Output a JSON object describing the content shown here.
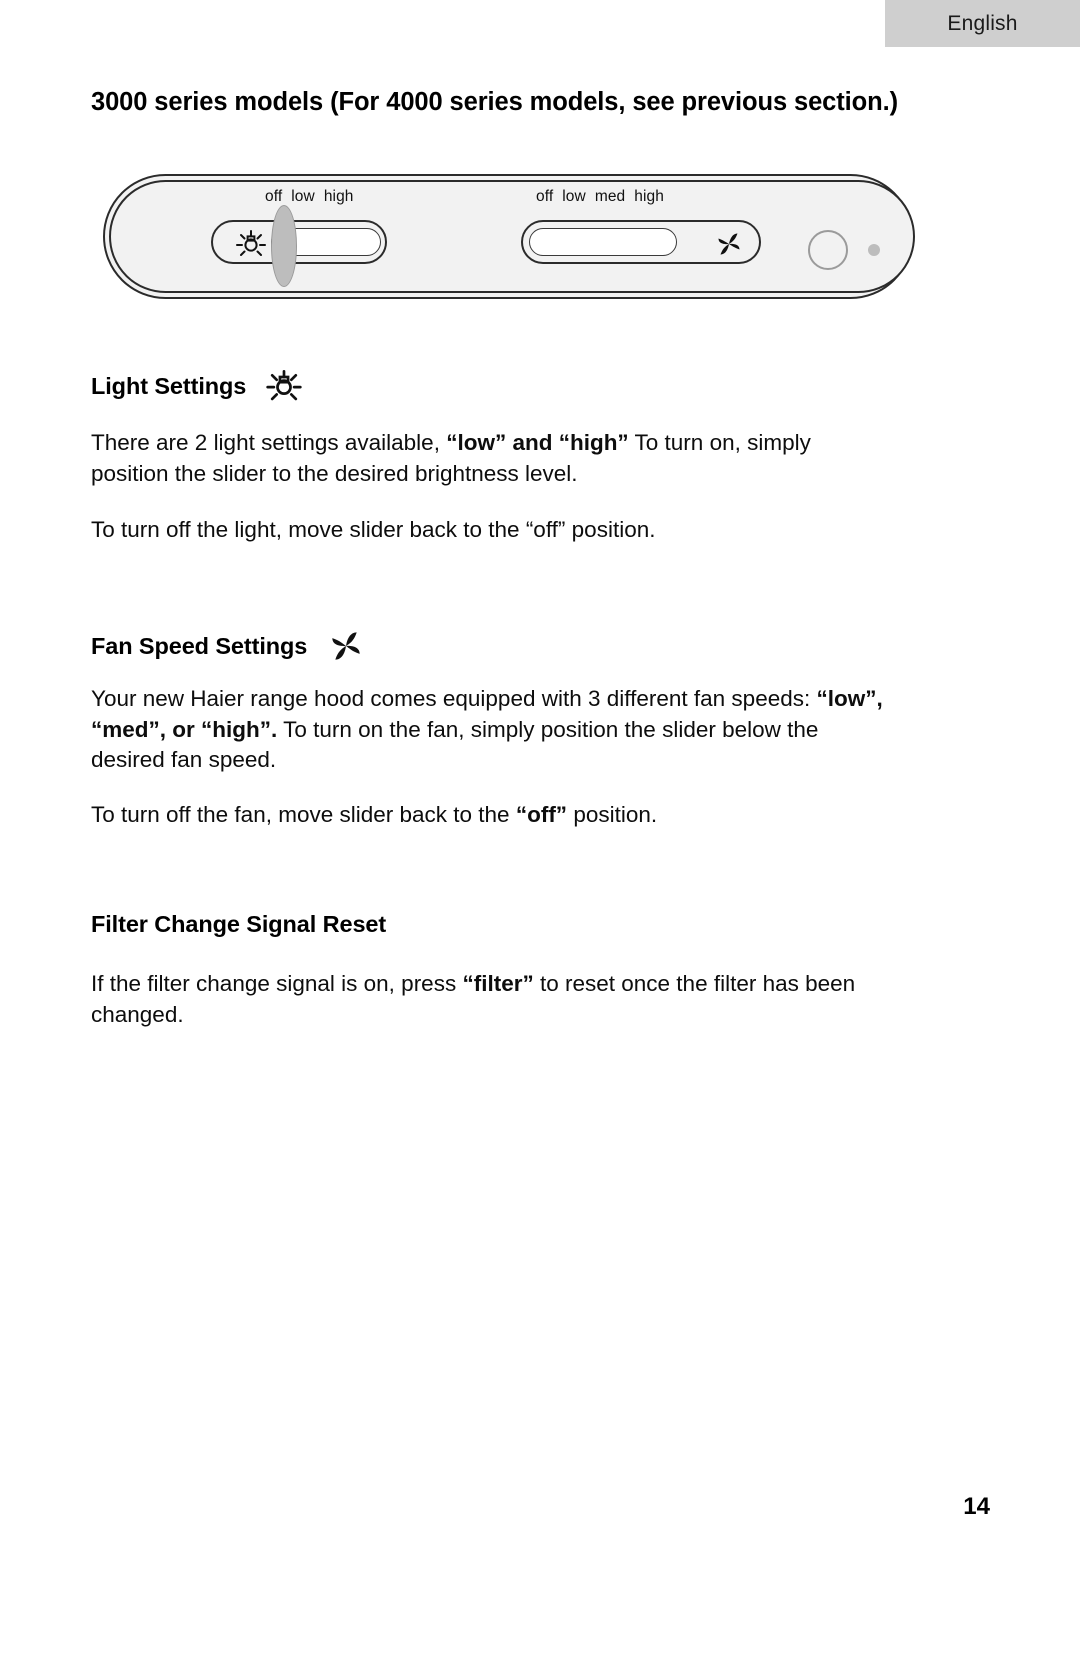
{
  "header": {
    "language_tab": "English"
  },
  "page": {
    "title": "3000 series models (For 4000 series models, see previous section.)",
    "page_number": "14"
  },
  "control_panel": {
    "light_slider": {
      "icon": "light-bulb-icon",
      "labels": [
        "off",
        "low",
        "high"
      ],
      "current_position": "off"
    },
    "fan_slider": {
      "icon": "fan-icon",
      "labels": [
        "off",
        "low",
        "med",
        "high"
      ],
      "current_position": "off"
    },
    "filter_button": "round-button",
    "indicator": "indicator-dot"
  },
  "sections": [
    {
      "heading": "Light Settings",
      "icon": "light-bulb-icon",
      "paragraphs": [
        {
          "parts": [
            {
              "text": "There are 2 light settings available, ",
              "bold": false
            },
            {
              "text": "“low” and “high”",
              "bold": true
            },
            {
              "text": " To turn on, simply position the slider to the desired brightness level.",
              "bold": false
            }
          ]
        },
        {
          "parts": [
            {
              "text": "To turn off the light, move slider back to the “off” position.",
              "bold": false
            }
          ]
        }
      ]
    },
    {
      "heading": "Fan Speed Settings",
      "icon": "fan-icon",
      "paragraphs": [
        {
          "parts": [
            {
              "text": "Your new Haier range hood comes equipped with 3 different fan speeds: ",
              "bold": false
            },
            {
              "text": "“low”, “med”, or “high”.",
              "bold": true
            },
            {
              "text": " To turn on the fan, simply position the slider below the desired fan speed.",
              "bold": false
            }
          ]
        },
        {
          "parts": [
            {
              "text": "To turn off the fan, move slider back to the ",
              "bold": false
            },
            {
              "text": "“off”",
              "bold": true
            },
            {
              "text": " position.",
              "bold": false
            }
          ]
        }
      ]
    },
    {
      "heading": "Filter Change Signal Reset",
      "icon": null,
      "paragraphs": [
        {
          "parts": [
            {
              "text": "If the filter change signal is on, press ",
              "bold": false
            },
            {
              "text": "“filter”",
              "bold": true
            },
            {
              "text": " to reset once the filter has been changed.",
              "bold": false
            }
          ]
        }
      ]
    }
  ]
}
